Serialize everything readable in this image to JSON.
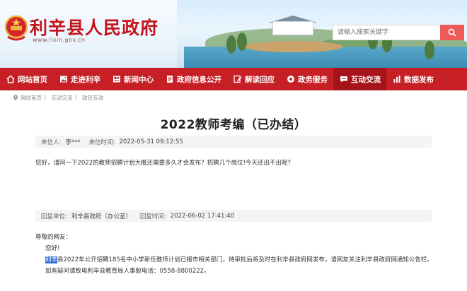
{
  "header": {
    "site_title": "利辛县人民政府",
    "site_url": "www.lixin.gov.cn",
    "search_placeholder": "请输入搜索关键字"
  },
  "nav": {
    "items": [
      {
        "label": "网站首页",
        "icon": "home-icon"
      },
      {
        "label": "走进利辛",
        "icon": "image-icon"
      },
      {
        "label": "新闻中心",
        "icon": "newspaper-icon"
      },
      {
        "label": "政府信息公开",
        "icon": "document-icon"
      },
      {
        "label": "解读回应",
        "icon": "edit-icon"
      },
      {
        "label": "政务服务",
        "icon": "service-icon"
      },
      {
        "label": "互动交流",
        "icon": "chat-icon"
      },
      {
        "label": "数据发布",
        "icon": "chart-icon"
      }
    ],
    "active_index": 6
  },
  "breadcrumb": {
    "items": [
      "网站首页",
      "互动交流",
      "政民互动"
    ],
    "separator": "〉"
  },
  "letter": {
    "title": "2022教师考编（已办结）",
    "sender_label": "来信人:",
    "sender": "李***",
    "time_label": "来信时间:",
    "time": "2022-05-31 09:12:55",
    "content": "您好，请问一下2022的教师招聘计划大概还需要多久才会发布？招聘几个岗位!今天还出不出呢？"
  },
  "reply": {
    "unit_label": "回复单位:",
    "unit": "利辛县政府（办公室）",
    "time_label": "回复时间:",
    "time": "2022-06-02 17:41:40",
    "greeting": "尊敬的网友：",
    "hello": "您好!",
    "highlight": "利辛",
    "body": "县2022年公开招聘185名中小学新任教师计划已报市相关部门，待审批后将及时在利辛县政府网发布，请网友关注利辛县政府网通知公告栏。",
    "contact": "如有疑问请致电利辛县教育局人事股电话：0558-8800222。"
  },
  "colors": {
    "brand_red": "#c61f25",
    "title_red": "#c5141c",
    "search_button": "#ef5a5a",
    "highlight": "#2f6fd6"
  }
}
